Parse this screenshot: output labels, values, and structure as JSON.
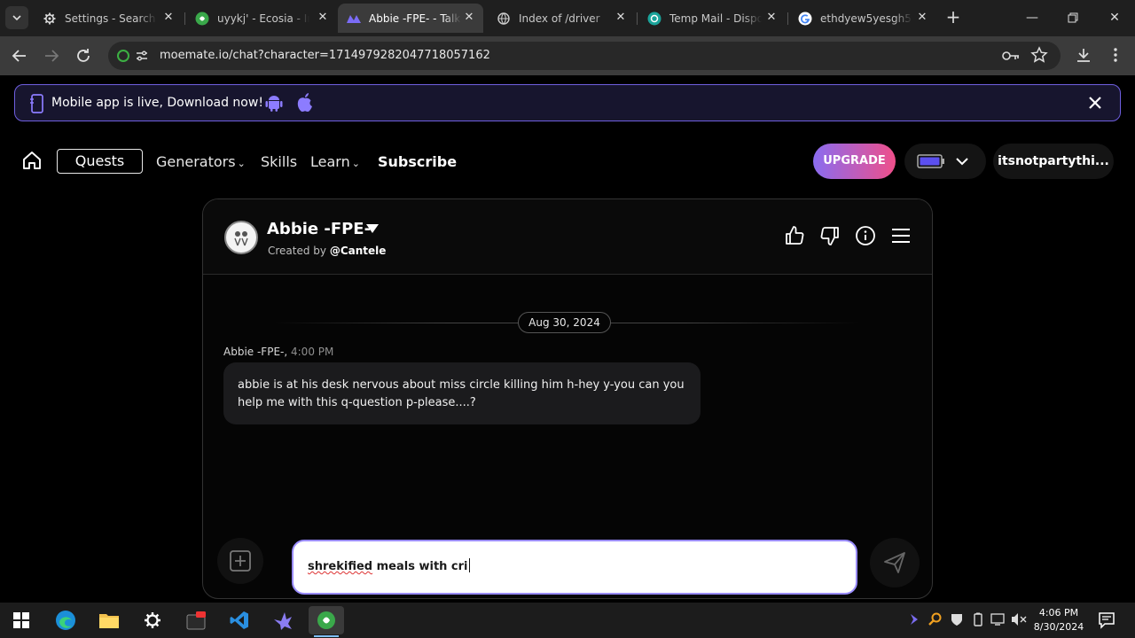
{
  "browser": {
    "tabs": [
      {
        "title": "Settings - Search e",
        "icon": "gear-icon"
      },
      {
        "title": "uyykj' - Ecosia - Im",
        "icon": "ecosia-icon"
      },
      {
        "title": "Abbie -FPE- - Talk",
        "icon": "moemate-icon"
      },
      {
        "title": "Index of /driver",
        "icon": "globe-icon"
      },
      {
        "title": "Temp Mail - Dispo",
        "icon": "tempmail-icon"
      },
      {
        "title": "ethdyew5yesgh5w",
        "icon": "google-icon"
      }
    ],
    "url": "moemate.io/chat?character=1714979282047718057162"
  },
  "banner": {
    "text": "Mobile app is live, Download now!"
  },
  "nav": {
    "quests": "Quests",
    "generators": "Generators",
    "skills": "Skills",
    "learn": "Learn",
    "subscribe": "Subscribe",
    "upgrade": "UPGRADE",
    "username": "itsnotpartythi..."
  },
  "chat": {
    "character_name": "Abbie -FPE-",
    "created_by_prefix": "Created by",
    "created_by_user": "@Cantele",
    "date": "Aug 30, 2024",
    "message": {
      "author": "Abbie -FPE-,",
      "time": "4:00 PM",
      "text": "abbie is at his desk nervous about miss circle killing him h-hey y-you can you help me with this q-question p-please....?"
    },
    "composer": {
      "misspelled_word": "shrekified",
      "rest_text": " meals with cri"
    }
  },
  "taskbar": {
    "time": "4:06 PM",
    "date": "8/30/2024"
  },
  "colors": {
    "accent": "#9a8cff",
    "upgrade_start": "#8a6cf0",
    "upgrade_end": "#ef4f8a",
    "banner_border": "#6f5fe0"
  }
}
